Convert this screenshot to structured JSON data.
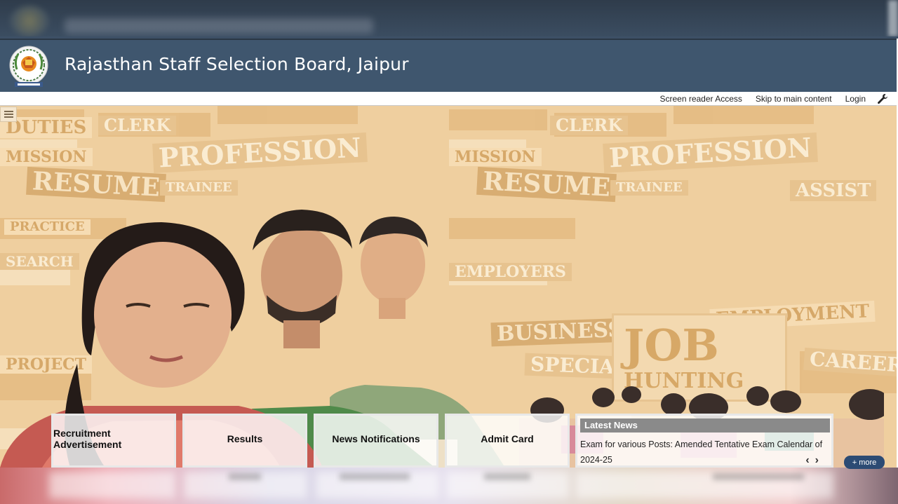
{
  "header": {
    "title": "Rajasthan Staff Selection Board, Jaipur",
    "logo_icon": "rsmssb-emblem-icon"
  },
  "utility_nav": {
    "links": [
      "Screen reader Access",
      "Skip to main content",
      "Login"
    ],
    "tools_icon": "wrench-icon"
  },
  "hero": {
    "menu_icon": "hamburger-menu-icon",
    "background_words": [
      "CLERK",
      "PROFESSION",
      "RESUME",
      "TRAINEE",
      "MISSION",
      "PRACTICE",
      "SEARCH",
      "EMPLOYERS",
      "BUSINESS",
      "SPECIALTY",
      "EMPLOYMENT",
      "CAREER",
      "ASSIST",
      "DUTIES",
      "PROJECT"
    ],
    "job_hunting": [
      "JOB",
      "HUNTING"
    ]
  },
  "tiles": [
    {
      "label": "Recruitment Advertisement"
    },
    {
      "label": "Results"
    },
    {
      "label": "News Notifications"
    },
    {
      "label": "Admit Card"
    }
  ],
  "news": {
    "heading": "Latest News",
    "item": "Exam for various Posts: Amended Tentative Exam Calendar of 2024-25",
    "prev": "‹",
    "next": "›",
    "more": "+ more"
  },
  "colors": {
    "header_bg": "#3f566e",
    "hero_tint": "#f1d3a5",
    "more_button": "#2c4b74"
  }
}
